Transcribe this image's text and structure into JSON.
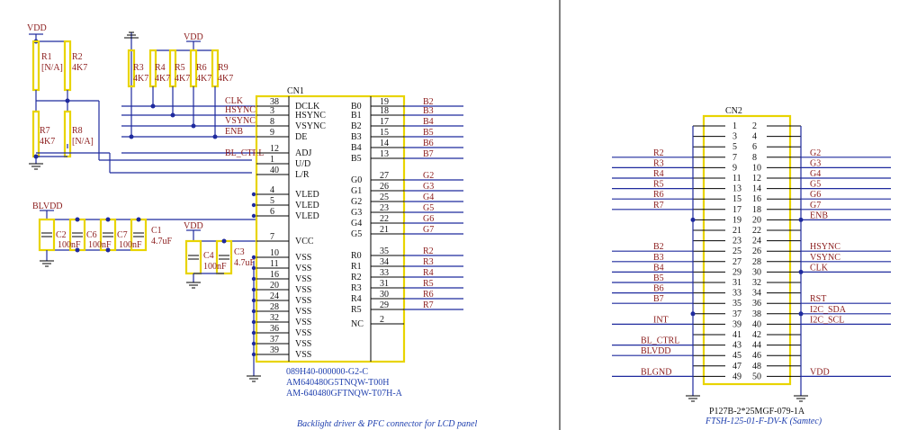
{
  "power": {
    "vdd": "VDD",
    "blvdd": "BLVDD",
    "blgnd": "BLGND"
  },
  "resistors": {
    "r1": {
      "ref": "R1",
      "val": "[N/A]"
    },
    "r2": {
      "ref": "R2",
      "val": "4K7"
    },
    "r7": {
      "ref": "R7",
      "val": "4K7"
    },
    "r8": {
      "ref": "R8",
      "val": "[N/A]"
    },
    "bank": [
      {
        "ref": "R3",
        "val": "4K7"
      },
      {
        "ref": "R4",
        "val": "4K7"
      },
      {
        "ref": "R5",
        "val": "4K7"
      },
      {
        "ref": "R6",
        "val": "4K7"
      },
      {
        "ref": "R9",
        "val": "4K7"
      }
    ]
  },
  "capacitors": {
    "c2": {
      "ref": "C2",
      "val": "100nF"
    },
    "c6": {
      "ref": "C6",
      "val": "100nF"
    },
    "c7": {
      "ref": "C7",
      "val": "100nF"
    },
    "c1": {
      "ref": "C1",
      "val": "4.7uF"
    },
    "c4": {
      "ref": "C4",
      "val": "100nF"
    },
    "c3": {
      "ref": "C3",
      "val": "4.7uF"
    }
  },
  "cn1": {
    "ref": "CN1",
    "part1": "089H40-000000-G2-C",
    "part2": "AM640480G5TNQW-T00H",
    "part3": "AM-640480GFTNQW-T07H-A",
    "left": [
      {
        "net": "CLK",
        "num": "38",
        "name": "DCLK"
      },
      {
        "net": "HSYNC",
        "num": "3",
        "name": "HSYNC"
      },
      {
        "net": "VSYNC",
        "num": "8",
        "name": "VSYNC"
      },
      {
        "net": "ENB",
        "num": "9",
        "name": "DE"
      },
      {
        "net": "BL_CTRL",
        "num": "12",
        "name": "ADJ"
      },
      {
        "net": "",
        "num": "1",
        "name": "U/D"
      },
      {
        "net": "",
        "num": "40",
        "name": "L/R"
      },
      {
        "net": "",
        "num": "4",
        "name": "VLED"
      },
      {
        "net": "",
        "num": "5",
        "name": "VLED"
      },
      {
        "net": "",
        "num": "6",
        "name": "VLED"
      },
      {
        "net": "",
        "num": "7",
        "name": "VCC"
      },
      {
        "net": "",
        "num": "10",
        "name": "VSS"
      },
      {
        "net": "",
        "num": "11",
        "name": "VSS"
      },
      {
        "net": "",
        "num": "16",
        "name": "VSS"
      },
      {
        "net": "",
        "num": "20",
        "name": "VSS"
      },
      {
        "net": "",
        "num": "24",
        "name": "VSS"
      },
      {
        "net": "",
        "num": "28",
        "name": "VSS"
      },
      {
        "net": "",
        "num": "32",
        "name": "VSS"
      },
      {
        "net": "",
        "num": "36",
        "name": "VSS"
      },
      {
        "net": "",
        "num": "37",
        "name": "VSS"
      },
      {
        "net": "",
        "num": "39",
        "name": "VSS"
      }
    ],
    "right": [
      {
        "name": "B0",
        "num": "19",
        "net": "B2"
      },
      {
        "name": "B1",
        "num": "18",
        "net": "B3"
      },
      {
        "name": "B2",
        "num": "17",
        "net": "B4"
      },
      {
        "name": "B3",
        "num": "15",
        "net": "B5"
      },
      {
        "name": "B4",
        "num": "14",
        "net": "B6"
      },
      {
        "name": "B5",
        "num": "13",
        "net": "B7"
      },
      {
        "name": "G0",
        "num": "27",
        "net": "G2"
      },
      {
        "name": "G1",
        "num": "26",
        "net": "G3"
      },
      {
        "name": "G2",
        "num": "25",
        "net": "G4"
      },
      {
        "name": "G3",
        "num": "23",
        "net": "G5"
      },
      {
        "name": "G4",
        "num": "22",
        "net": "G6"
      },
      {
        "name": "G5",
        "num": "21",
        "net": "G7"
      },
      {
        "name": "R0",
        "num": "35",
        "net": "R2"
      },
      {
        "name": "R1",
        "num": "34",
        "net": "R3"
      },
      {
        "name": "R2",
        "num": "33",
        "net": "R4"
      },
      {
        "name": "R3",
        "num": "31",
        "net": "R5"
      },
      {
        "name": "R4",
        "num": "30",
        "net": "R6"
      },
      {
        "name": "R5",
        "num": "29",
        "net": "R7"
      },
      {
        "name": "NC",
        "num": "2",
        "net": ""
      }
    ]
  },
  "cn2": {
    "ref": "CN2",
    "part1": "P127B-2*25MGF-079-1A",
    "part2": "FTSH-125-01-F-DV-K (Samtec)",
    "rows": [
      {
        "l": "",
        "a": "1",
        "b": "2",
        "r": ""
      },
      {
        "l": "",
        "a": "3",
        "b": "4",
        "r": ""
      },
      {
        "l": "",
        "a": "5",
        "b": "6",
        "r": ""
      },
      {
        "l": "R2",
        "a": "7",
        "b": "8",
        "r": "G2"
      },
      {
        "l": "R3",
        "a": "9",
        "b": "10",
        "r": "G3"
      },
      {
        "l": "R4",
        "a": "11",
        "b": "12",
        "r": "G4"
      },
      {
        "l": "R5",
        "a": "13",
        "b": "14",
        "r": "G5"
      },
      {
        "l": "R6",
        "a": "15",
        "b": "16",
        "r": "G6"
      },
      {
        "l": "R7",
        "a": "17",
        "b": "18",
        "r": "G7"
      },
      {
        "l": "",
        "a": "19",
        "b": "20",
        "r": "ENB"
      },
      {
        "l": "",
        "a": "21",
        "b": "22",
        "r": ""
      },
      {
        "l": "",
        "a": "23",
        "b": "24",
        "r": ""
      },
      {
        "l": "B2",
        "a": "25",
        "b": "26",
        "r": "HSYNC"
      },
      {
        "l": "B3",
        "a": "27",
        "b": "28",
        "r": "VSYNC"
      },
      {
        "l": "B4",
        "a": "29",
        "b": "30",
        "r": "CLK"
      },
      {
        "l": "B5",
        "a": "31",
        "b": "32",
        "r": ""
      },
      {
        "l": "B6",
        "a": "33",
        "b": "34",
        "r": ""
      },
      {
        "l": "B7",
        "a": "35",
        "b": "36",
        "r": "RST"
      },
      {
        "l": "",
        "a": "37",
        "b": "38",
        "r": "I2C_SDA"
      },
      {
        "l": "INT",
        "a": "39",
        "b": "40",
        "r": "I2C_SCL"
      },
      {
        "l": "",
        "a": "41",
        "b": "42",
        "r": ""
      },
      {
        "l": "BL_CTRL",
        "a": "43",
        "b": "44",
        "r": ""
      },
      {
        "l": "BLVDD",
        "a": "45",
        "b": "46",
        "r": ""
      },
      {
        "l": "",
        "a": "47",
        "b": "48",
        "r": ""
      },
      {
        "l": "BLGND",
        "a": "49",
        "b": "50",
        "r": "VDD"
      }
    ]
  },
  "caption": "Backlight driver & PFC connector for LCD panel"
}
